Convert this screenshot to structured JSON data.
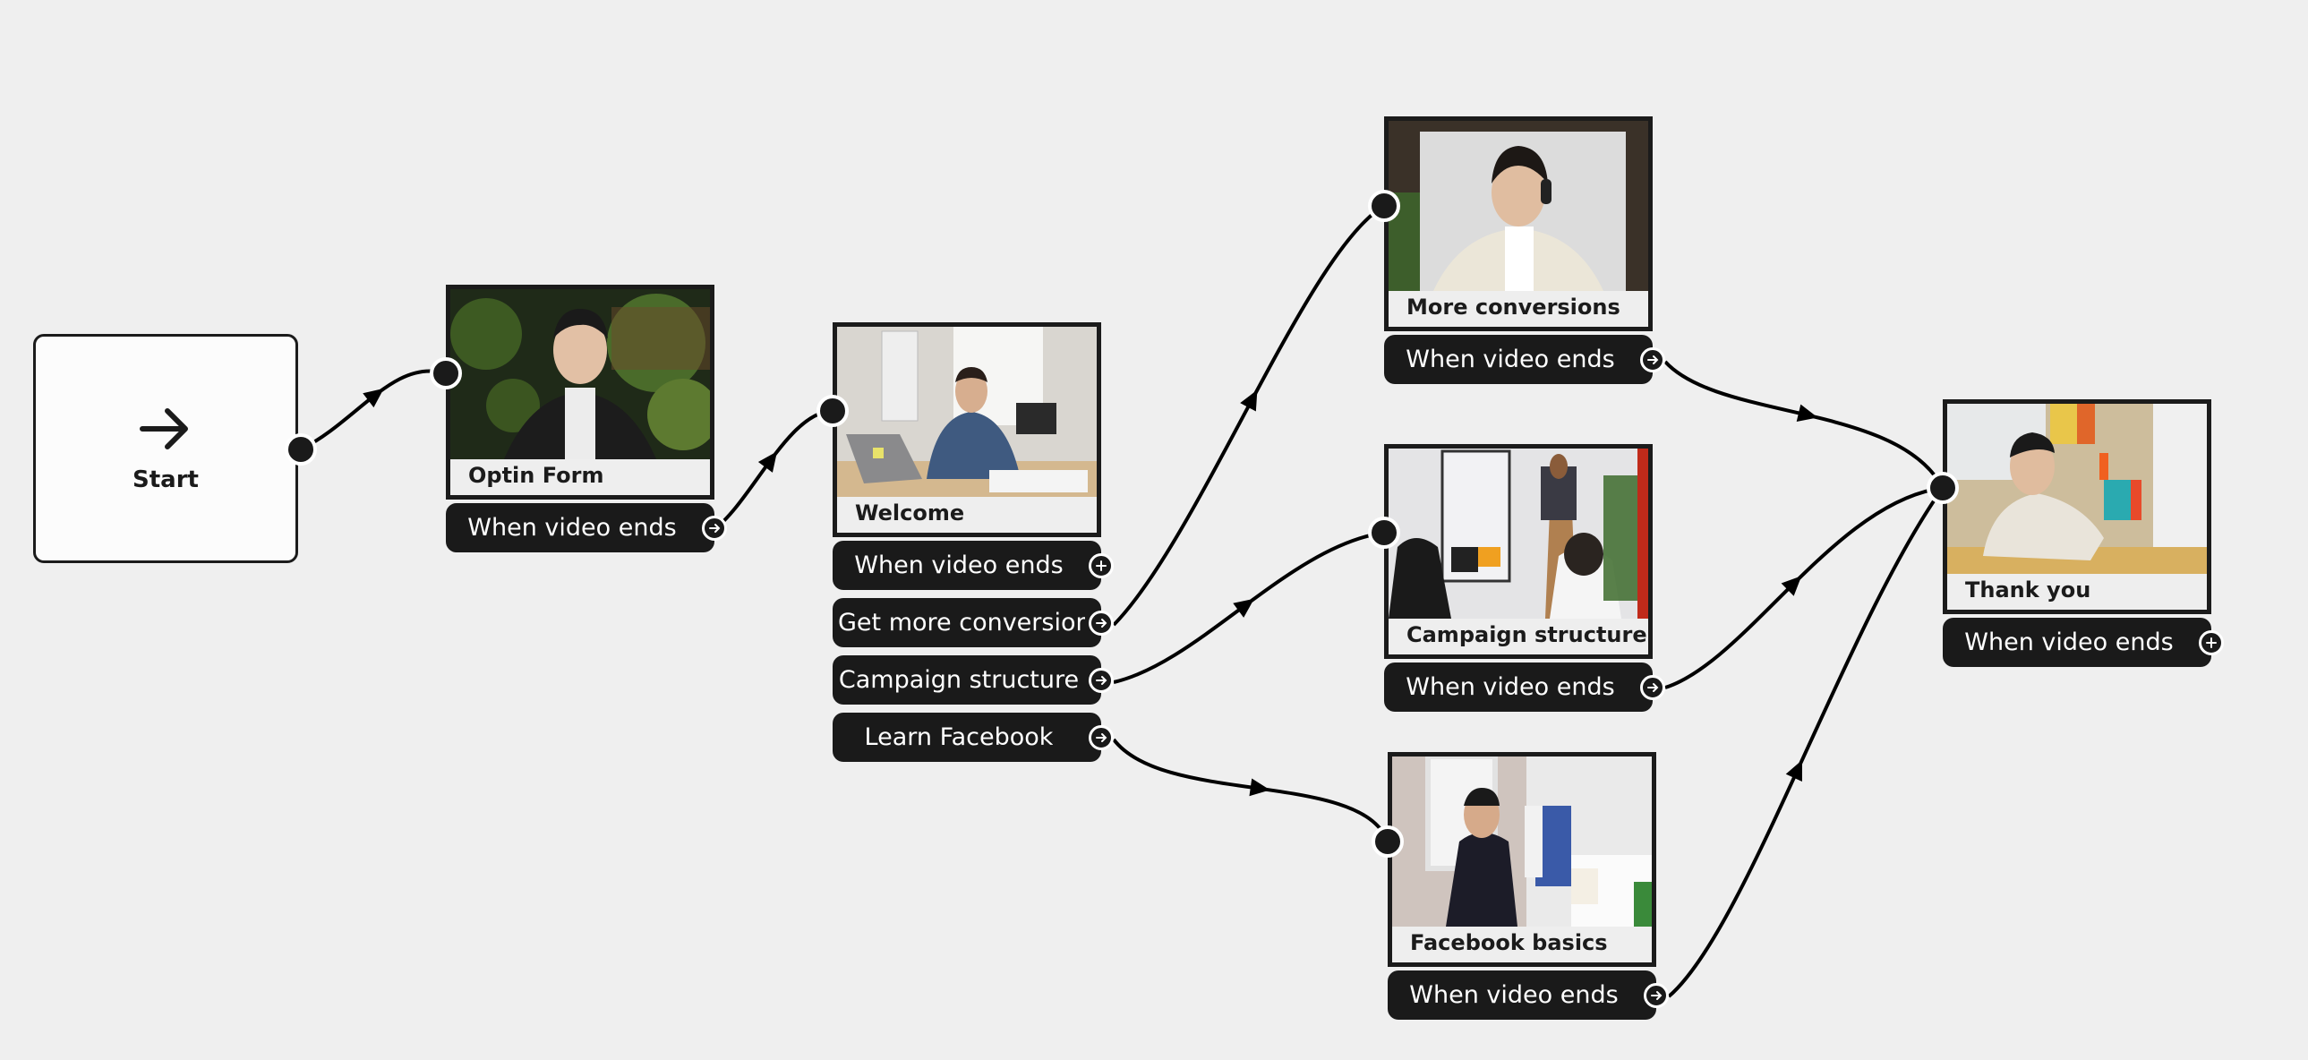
{
  "canvas": {
    "background": "#efefef",
    "node_border": "#1b1b1b",
    "button_bg": "#1a1a1a"
  },
  "start": {
    "label": "Start",
    "icon": "arrow-right-icon"
  },
  "nodes": [
    {
      "id": "optin",
      "title": "Optin Form",
      "actions": [
        {
          "label": "When video ends",
          "port": "connected"
        }
      ]
    },
    {
      "id": "welcome",
      "title": "Welcome",
      "actions": [
        {
          "label": "When video ends",
          "port": "add"
        },
        {
          "label": "Get more conversions",
          "port": "connected"
        },
        {
          "label": "Campaign structure",
          "port": "connected"
        },
        {
          "label": "Learn Facebook",
          "port": "connected"
        }
      ]
    },
    {
      "id": "more",
      "title": "More conversions",
      "actions": [
        {
          "label": "When video ends",
          "port": "connected"
        }
      ]
    },
    {
      "id": "campaign",
      "title": "Campaign structure",
      "actions": [
        {
          "label": "When video ends",
          "port": "connected"
        }
      ]
    },
    {
      "id": "facebook",
      "title": "Facebook basics",
      "actions": [
        {
          "label": "When video ends",
          "port": "connected"
        }
      ]
    },
    {
      "id": "thanks",
      "title": "Thank you",
      "actions": [
        {
          "label": "When video ends",
          "port": "add"
        }
      ]
    }
  ],
  "edges": [
    {
      "from": "start",
      "to": "Optin Form"
    },
    {
      "from": "Optin Form / When video ends",
      "to": "Welcome"
    },
    {
      "from": "Welcome / Get more conversions",
      "to": "More conversions"
    },
    {
      "from": "Welcome / Campaign structure",
      "to": "Campaign structure"
    },
    {
      "from": "Welcome / Learn Facebook",
      "to": "Facebook basics"
    },
    {
      "from": "More conversions / When video ends",
      "to": "Thank you"
    },
    {
      "from": "Campaign structure / When video ends",
      "to": "Thank you"
    },
    {
      "from": "Facebook basics / When video ends",
      "to": "Thank you"
    }
  ]
}
